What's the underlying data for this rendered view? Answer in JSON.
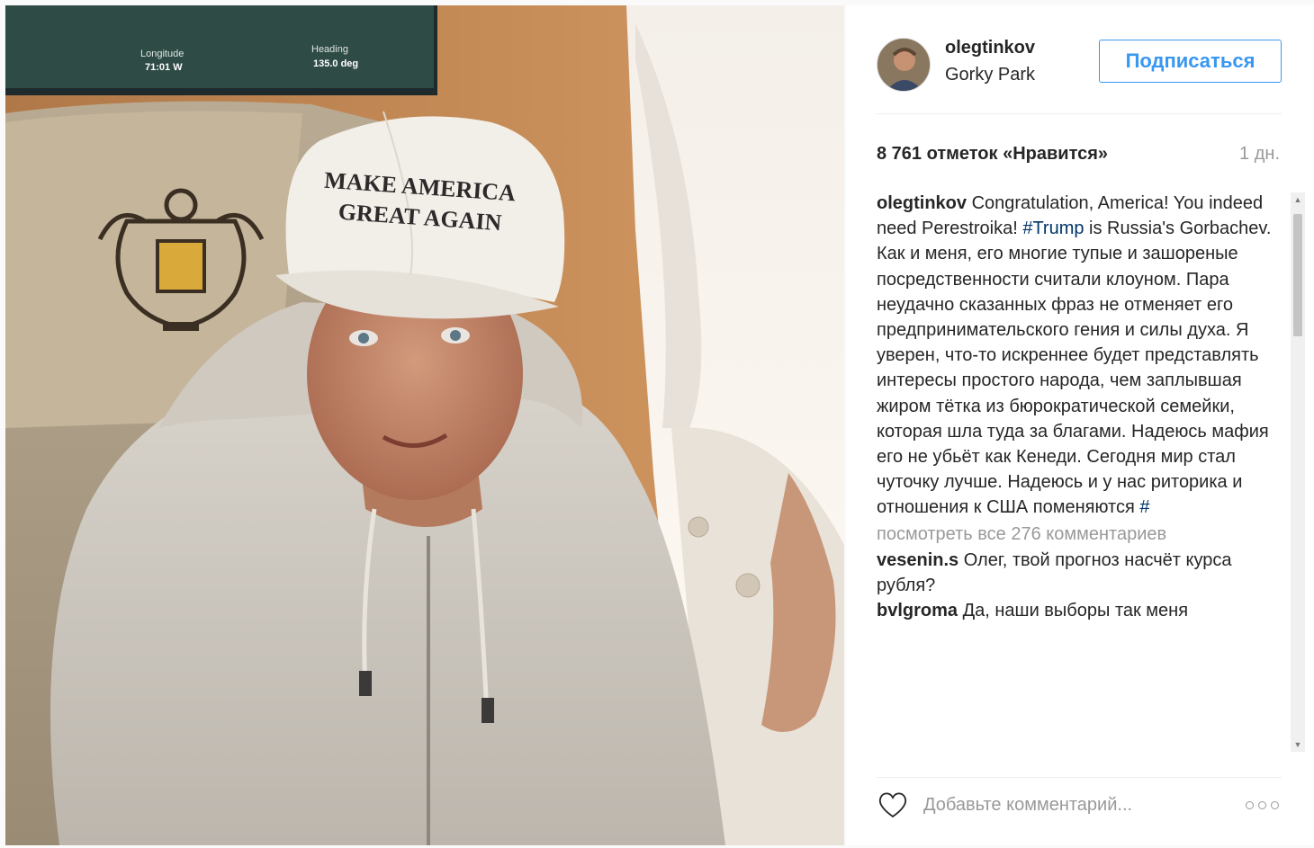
{
  "photo": {
    "monitor_labels": {
      "left_label": "Longitude",
      "left_value": "71:01 W",
      "right_label": "Heading",
      "right_value": "135.0 deg"
    },
    "cap_text_line1": "MAKE AMERICA",
    "cap_text_line2": "GREAT AGAIN"
  },
  "header": {
    "username": "olegtinkov",
    "location": "Gorky Park",
    "follow_label": "Подписаться"
  },
  "meta": {
    "likes": "8 761 отметок «Нравится»",
    "time": "1 дн."
  },
  "caption": {
    "user": "olegtinkov",
    "text_before_tag": " Congratulation, America! You indeed need Perestroika! ",
    "tag": "#Trump",
    "text_after_tag": " is Russia's Gorbachev. Как и меня, его многие тупые и зашореные посредственности считали клоуном. Пара неудачно сказанных фраз не отменяет его предпринимательского гения и силы духа. Я уверен, что-то искреннее будет представлять интересы простого народа, чем заплывшая жиром тётка из бюрократической семейки, которая шла туда за благами. Надеюсь мафия его не убьёт как Кенеди. Сегодня мир стал чуточку лучше. Надеюсь и у нас риторика и отношения к США поменяются ",
    "trailing_tag": "#"
  },
  "view_all_comments": "посмотреть все 276 комментариев",
  "comments": [
    {
      "user": "vesenin.s",
      "text": " Олег, твой прогноз насчёт курса рубля?"
    },
    {
      "user": "bvlgroma",
      "text": " Да, наши выборы так меня"
    }
  ],
  "add_comment": {
    "placeholder": "Добавьте комментарий..."
  },
  "colors": {
    "follow_blue": "#3897f0",
    "hashtag": "#003569",
    "muted": "#999999",
    "text": "#262626"
  },
  "icons": {
    "heart": "heart-icon",
    "more": "more-options-icon",
    "scroll_up": "scroll-up-arrow",
    "scroll_down": "scroll-down-arrow"
  }
}
